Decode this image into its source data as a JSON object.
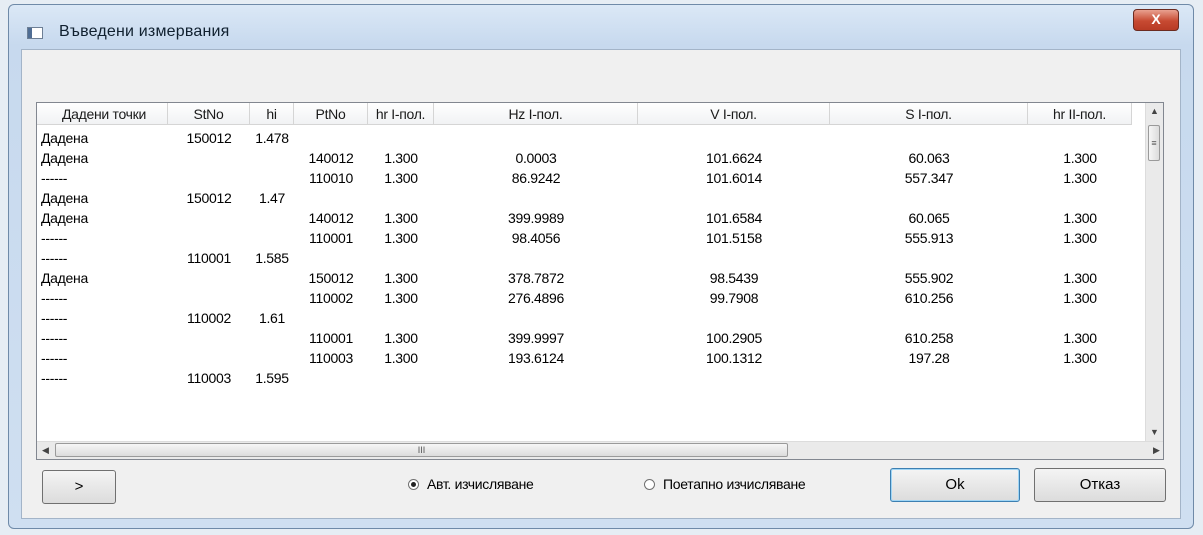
{
  "window": {
    "title": "Въведени измервания",
    "close_label": "X"
  },
  "table": {
    "columns": [
      "Дадени точки",
      "StNo",
      "hi",
      "PtNo",
      "hr I-пол.",
      "Hz  I-пол.",
      "V  I-пол.",
      "S  I-пол.",
      "hr II-пол."
    ],
    "rows": [
      [
        "Дадена",
        "150012",
        "1.478",
        "",
        "",
        "",
        "",
        "",
        ""
      ],
      [
        "Дадена",
        "",
        "",
        "140012",
        "1.300",
        "0.0003",
        "101.6624",
        "60.063",
        "1.300"
      ],
      [
        "------",
        "",
        "",
        "110010",
        "1.300",
        "86.9242",
        "101.6014",
        "557.347",
        "1.300"
      ],
      [
        "Дадена",
        "150012",
        "1.47",
        "",
        "",
        "",
        "",
        "",
        ""
      ],
      [
        "Дадена",
        "",
        "",
        "140012",
        "1.300",
        "399.9989",
        "101.6584",
        "60.065",
        "1.300"
      ],
      [
        "------",
        "",
        "",
        "110001",
        "1.300",
        "98.4056",
        "101.5158",
        "555.913",
        "1.300"
      ],
      [
        "------",
        "110001",
        "1.585",
        "",
        "",
        "",
        "",
        "",
        ""
      ],
      [
        "Дадена",
        "",
        "",
        "150012",
        "1.300",
        "378.7872",
        "98.5439",
        "555.902",
        "1.300"
      ],
      [
        "------",
        "",
        "",
        "110002",
        "1.300",
        "276.4896",
        "99.7908",
        "610.256",
        "1.300"
      ],
      [
        "------",
        "110002",
        "1.61",
        "",
        "",
        "",
        "",
        "",
        ""
      ],
      [
        "------",
        "",
        "",
        "110001",
        "1.300",
        "399.9997",
        "100.2905",
        "610.258",
        "1.300"
      ],
      [
        "------",
        "",
        "",
        "110003",
        "1.300",
        "193.6124",
        "100.1312",
        "197.28",
        "1.300"
      ],
      [
        "------",
        "110003",
        "1.595",
        "",
        "",
        "",
        "",
        "",
        ""
      ]
    ]
  },
  "scroll": {
    "thumb_grip": "III",
    "vthumb_grip": "≡"
  },
  "buttons": {
    "next_label": ">",
    "ok_label": "Ok",
    "cancel_label": "Отказ"
  },
  "options": {
    "auto": {
      "label": "Авт. изчисляване",
      "checked": true
    },
    "step": {
      "label": "Поетапно изчисляване",
      "checked": false
    }
  }
}
